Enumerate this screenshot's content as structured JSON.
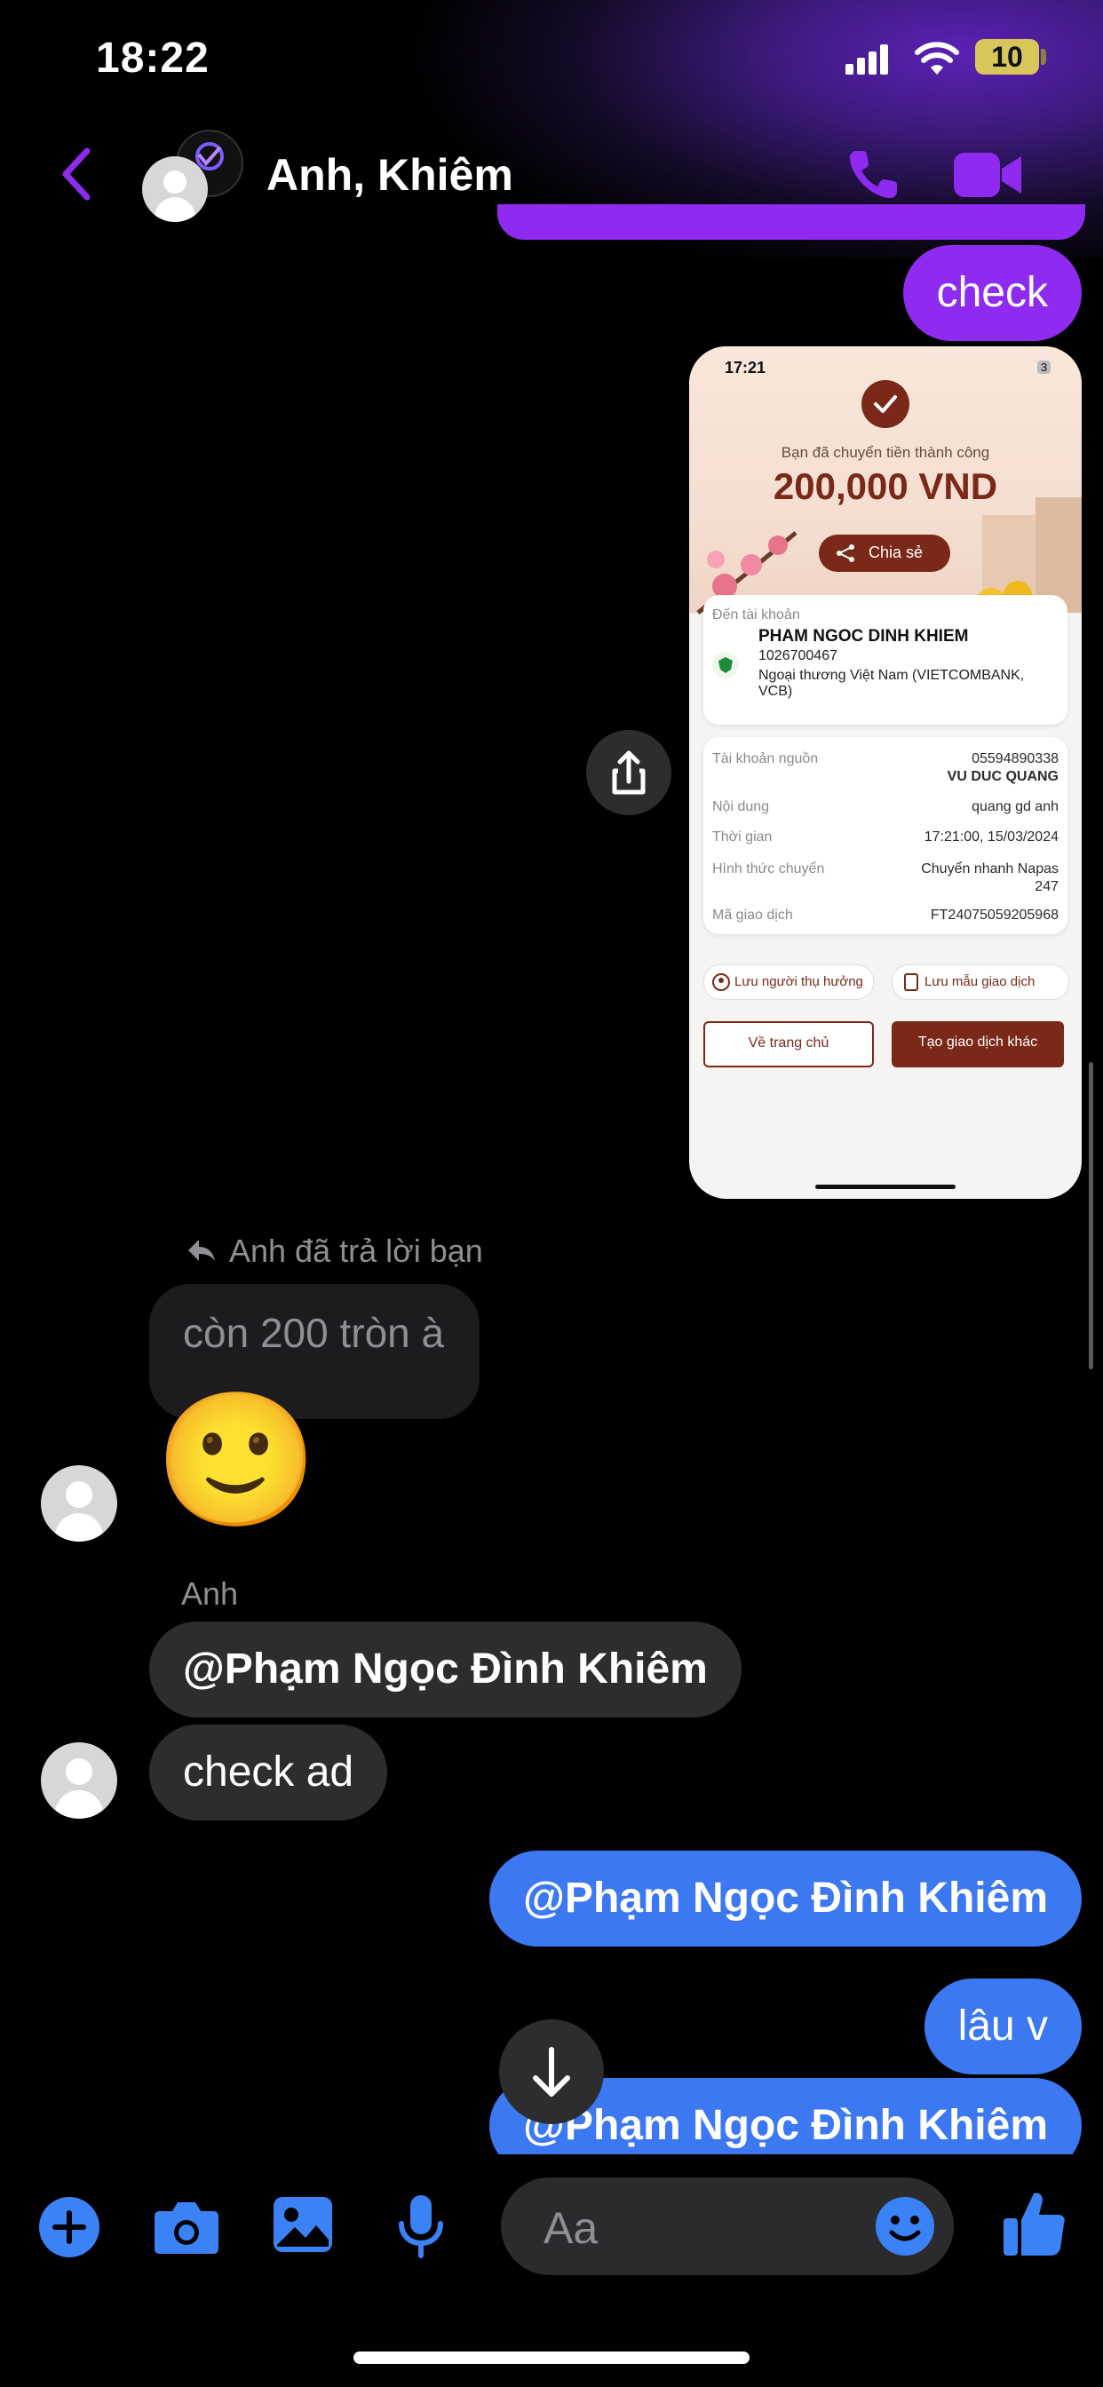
{
  "status_bar": {
    "time": "18:22",
    "battery": "10"
  },
  "header": {
    "title": "Anh, Khiêm"
  },
  "messages": {
    "check": "check",
    "reply_note": "Anh đã trả lời bạn",
    "reply_quote": "còn 200 tròn à",
    "reaction_emoji": "🙂",
    "sender_name": "Anh",
    "mention_1": "@Phạm Ngọc Đình Khiêm",
    "check_ad": "check ad",
    "mention_2": "@Phạm Ngọc Đình Khiêm",
    "lau_v": "lâu v",
    "mention_3": "@Phạm Ngọc Đình Khiêm"
  },
  "receipt": {
    "time": "17:21",
    "battery": "3",
    "headline": "Bạn đã chuyển tiền thành công",
    "amount": "200,000 VND",
    "share": "Chia sẻ",
    "to_account_label": "Đến tài khoản",
    "recipient_name": "PHAM NGOC DINH KHIEM",
    "recipient_account": "1026700467",
    "bank_line1": "Ngoại thương Việt Nam (VIETCOMBANK,",
    "bank_line2": "VCB)",
    "details": {
      "source_label": "Tài khoản nguồn",
      "source_account": "05594890338",
      "source_name": "VU DUC QUANG",
      "content_label": "Nội dung",
      "content_value": "quang gd anh",
      "time_label": "Thời gian",
      "time_value": "17:21:00, 15/03/2024",
      "method_label": "Hình thức chuyển",
      "method_value1": "Chuyển nhanh Napas",
      "method_value2": "247",
      "txid_label": "Mã giao dịch",
      "txid_value": "FT24075059205968"
    },
    "save_beneficiary": "Lưu người thụ hưởng",
    "save_template": "Lưu mẫu giao dịch",
    "home_button": "Về trang chủ",
    "new_tx_button": "Tạo giao dịch khác"
  },
  "composer": {
    "placeholder": "Aa"
  },
  "colors": {
    "accent_purple": "#8f2bf0",
    "bubble_blue": "#3c78f2",
    "icon_blue": "#3b82f6",
    "receipt_brown": "#7a2818"
  }
}
